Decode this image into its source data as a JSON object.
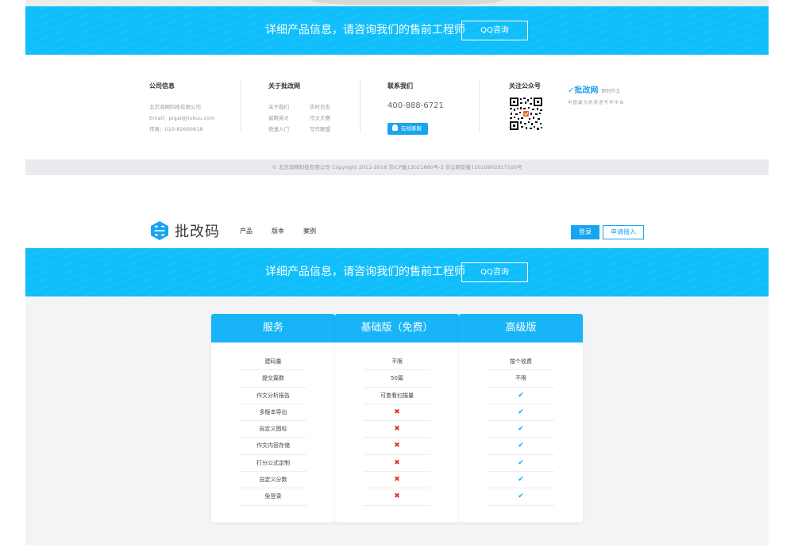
{
  "banner": {
    "text": "详细产品信息，请咨询我们的售前工程师",
    "button": "QQ咨询"
  },
  "footer": {
    "company": {
      "title": "公司信息",
      "lines": [
        "北京润网科技有限公司",
        "Email：pigai@jiukuu.com",
        "传真：010-82600818"
      ]
    },
    "about": {
      "title": "关于批改网",
      "links": [
        "关于我们",
        "实时日志",
        "诚聘英才",
        "作文大赛",
        "快速入门",
        "写作联盟"
      ]
    },
    "contact": {
      "title": "联系我们",
      "phone": "400-888-6721",
      "service_button": "在线客服"
    },
    "follow": {
      "title": "关注公众号"
    },
    "brand": {
      "name": "批改网",
      "slogan": "即时作文",
      "sub": "中国最大的英语写作平台"
    },
    "copyright": "© 北京润网科技有限公司 Copyright 2011-2016 京ICP备13021860号-3 京公网安备11010802017100号"
  },
  "nav": {
    "logo_text": "批改码",
    "menu": [
      "产品",
      "版本",
      "案例"
    ],
    "login": "登录",
    "apply": "申请接入"
  },
  "pricing": {
    "columns": [
      {
        "header": "服务",
        "rows": [
          "建码量",
          "提交篇数",
          "作文分析报告",
          "多版本导出",
          "自定义图标",
          "作文内容存储",
          "打分公式定制",
          "自定义分数",
          "免登录"
        ]
      },
      {
        "header": "基础版（免费）",
        "rows": [
          "不限",
          "50篇",
          "可查看扫描量",
          "cross",
          "cross",
          "cross",
          "cross",
          "cross",
          "cross"
        ]
      },
      {
        "header": "高级版",
        "rows": [
          "按个收费",
          "不限",
          "check",
          "check",
          "check",
          "check",
          "check",
          "check",
          "check"
        ]
      }
    ]
  },
  "colors": {
    "accent": "#0fbefa",
    "button_blue": "#18a5f0",
    "cross_red": "#e62d2d"
  },
  "icons": {
    "check": "check-icon",
    "cross": "cross-icon",
    "penguin": "qq-penguin-icon"
  }
}
